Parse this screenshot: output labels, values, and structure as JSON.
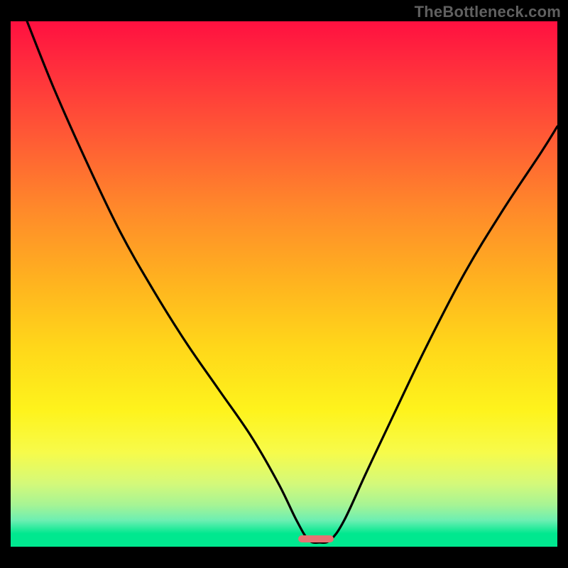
{
  "watermark": "TheBottleneck.com",
  "colors": {
    "page_bg": "#000000",
    "watermark": "#606060",
    "curve_stroke": "#000000",
    "marker_fill": "#e57373"
  },
  "chart_data": {
    "type": "line",
    "title": "",
    "xlabel": "",
    "ylabel": "",
    "xlim": [
      0,
      100
    ],
    "ylim": [
      0,
      100
    ],
    "grid": false,
    "legend": false,
    "series": [
      {
        "name": "bottleneck-curve",
        "x": [
          3,
          8,
          14,
          20,
          26,
          32,
          38,
          44,
          49,
          52.3,
          54.5,
          56.5,
          58.5,
          61,
          65,
          70,
          76,
          83,
          90,
          97,
          100
        ],
        "y": [
          100,
          87,
          73,
          60,
          49,
          39,
          30,
          21,
          12,
          5,
          1.3,
          0.8,
          1.3,
          5,
          14,
          25,
          38,
          52,
          64,
          75,
          80
        ]
      }
    ],
    "marker": {
      "name": "baseline-marker",
      "x_center": 55.8,
      "width_pct": 6.5,
      "y": 0.9,
      "color": "#e57373"
    },
    "background_gradient_stops": [
      {
        "pos": 0,
        "color": "#ff1040"
      },
      {
        "pos": 8,
        "color": "#ff2b3d"
      },
      {
        "pos": 22,
        "color": "#ff5a35"
      },
      {
        "pos": 36,
        "color": "#ff8a2a"
      },
      {
        "pos": 50,
        "color": "#ffb41f"
      },
      {
        "pos": 62,
        "color": "#ffd71a"
      },
      {
        "pos": 74,
        "color": "#fef31c"
      },
      {
        "pos": 82,
        "color": "#f7fb4a"
      },
      {
        "pos": 88,
        "color": "#d4f97a"
      },
      {
        "pos": 92,
        "color": "#a7f494"
      },
      {
        "pos": 95,
        "color": "#6cefb2"
      },
      {
        "pos": 97.5,
        "color": "#00e88f"
      },
      {
        "pos": 100,
        "color": "#00e88f"
      }
    ]
  }
}
